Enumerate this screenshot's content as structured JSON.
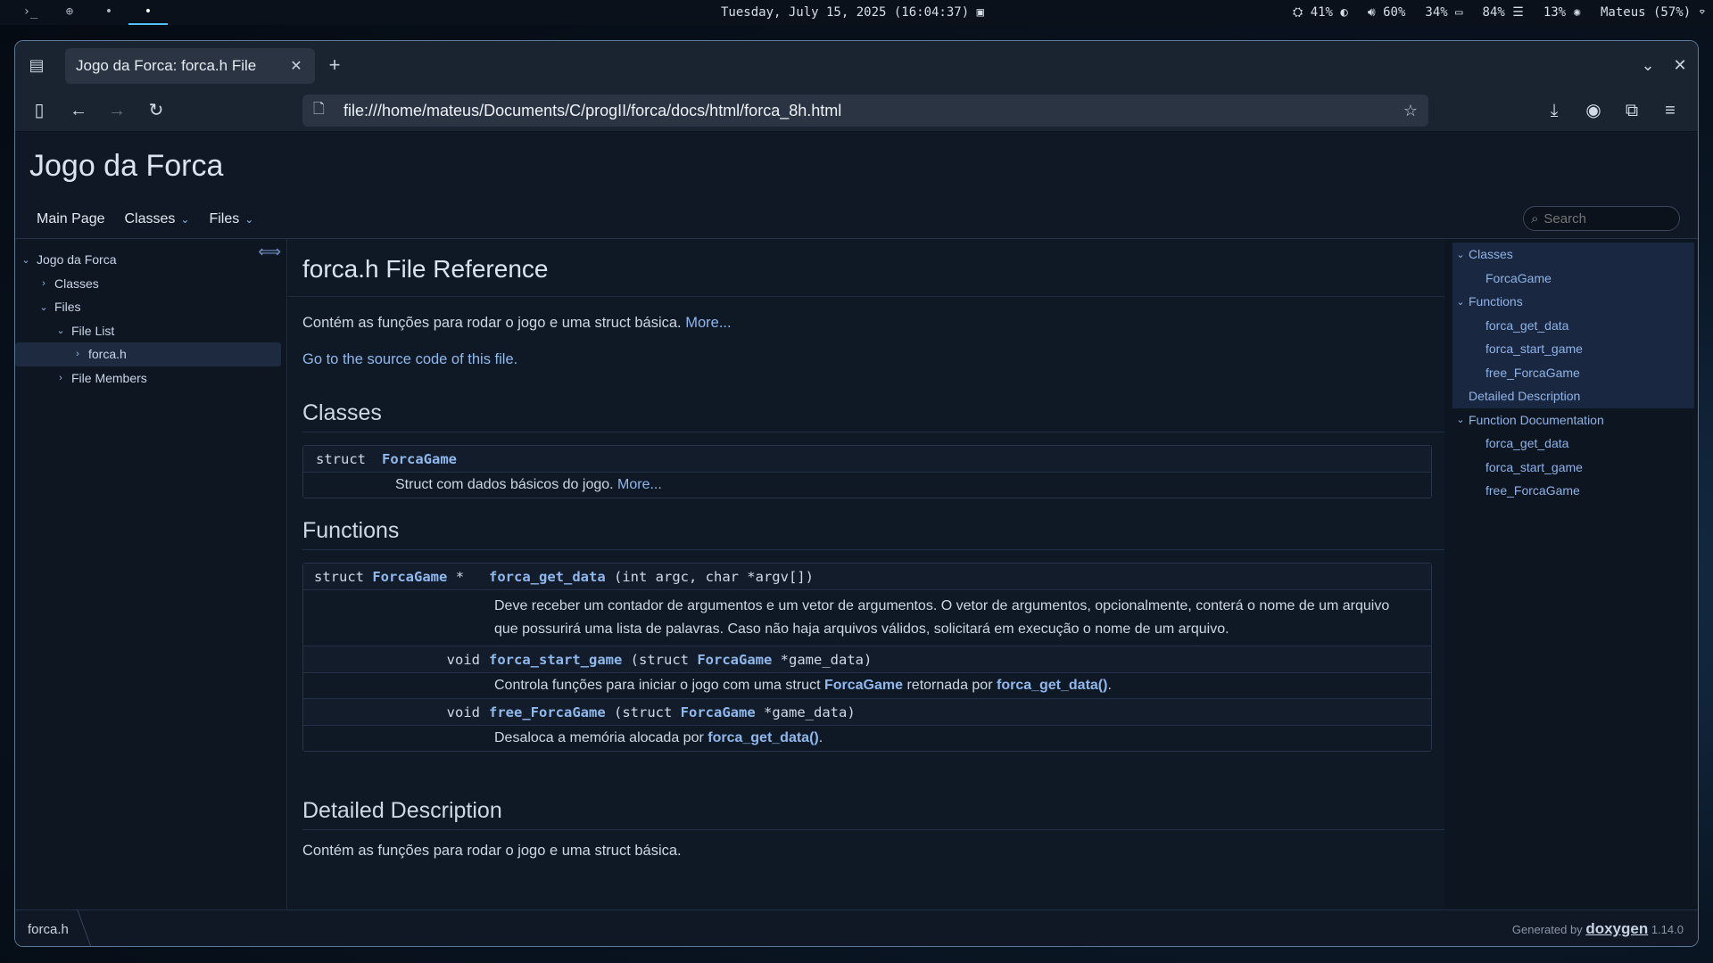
{
  "system_bar": {
    "workspaces": [
      "›_",
      "⊕",
      "•",
      "•"
    ],
    "active_workspace": 3,
    "clock": "Tuesday, July 15, 2025 (16:04:37)",
    "status": {
      "brightness": "41%",
      "volume": "60%",
      "battery": "34%",
      "memory": "84%",
      "cpu": "13%",
      "network": "Mateus (57%)"
    }
  },
  "browser": {
    "tab_title": "Jogo da Forca: forca.h File",
    "url": "file:///home/mateus/Documents/C/progII/forca/docs/html/forca_8h.html"
  },
  "doc": {
    "project_name": "Jogo da Forca",
    "topnav": [
      "Main Page",
      "Classes",
      "Files"
    ],
    "search_placeholder": "Search",
    "tree": {
      "root": "Jogo da Forca",
      "classes": "Classes",
      "files": "Files",
      "file_list": "File List",
      "current_file": "forca.h",
      "file_members": "File Members"
    },
    "title": "forca.h File Reference",
    "brief": "Contém as funções para rodar o jogo e uma struct básica.",
    "more_link": "More...",
    "source_link": "Go to the source code of this file.",
    "classes_heading": "Classes",
    "class_kw": "struct",
    "class_name": "ForcaGame",
    "class_desc": "Struct com dados básicos do jogo.",
    "functions_heading": "Functions",
    "functions": [
      {
        "ret_kw": "struct",
        "ret_type": "ForcaGame",
        "ret_ptr": "*",
        "name": "forca_get_data",
        "args": "(int argc, char *argv[])",
        "desc": "Deve receber um contador de argumentos e um vetor de argumentos. O vetor de argumentos, opcionalmente, conterá o nome de um arquivo que possurirá uma lista de palavras. Caso não haja arquivos válidos, solicitará em execução o nome de um arquivo."
      },
      {
        "ret_kw": "void",
        "name": "forca_start_game",
        "args_open": "(struct",
        "args_type": "ForcaGame",
        "args_close": "*game_data)",
        "desc_pre": "Controla funções para iniciar o jogo com uma struct",
        "desc_type": "ForcaGame",
        "desc_mid": "retornada por",
        "desc_link": "forca_get_data()",
        "desc_end": "."
      },
      {
        "ret_kw": "void",
        "name": "free_ForcaGame",
        "args_open": "(struct",
        "args_type": "ForcaGame",
        "args_close": "*game_data)",
        "desc_pre": "Desaloca a memória alocada por",
        "desc_link": "forca_get_data()",
        "desc_end": "."
      }
    ],
    "detailed_heading": "Detailed Description",
    "detailed_text": "Contém as funções para rodar o jogo e uma struct básica.",
    "right_nav": {
      "classes": "Classes",
      "classes_items": [
        "ForcaGame"
      ],
      "functions": "Functions",
      "functions_items": [
        "forca_get_data",
        "forca_start_game",
        "free_ForcaGame"
      ],
      "detailed": "Detailed Description",
      "func_doc": "Function Documentation",
      "func_doc_items": [
        "forca_get_data",
        "forca_start_game",
        "free_ForcaGame"
      ]
    },
    "footer": {
      "breadcrumb": "forca.h",
      "generated_by": "Generated by",
      "tool": "doxygen",
      "version": "1.14.0"
    }
  },
  "colors": {
    "accent": "#4fc3f7",
    "link": "#8fb8ec",
    "window_border": "#5c7a99"
  }
}
